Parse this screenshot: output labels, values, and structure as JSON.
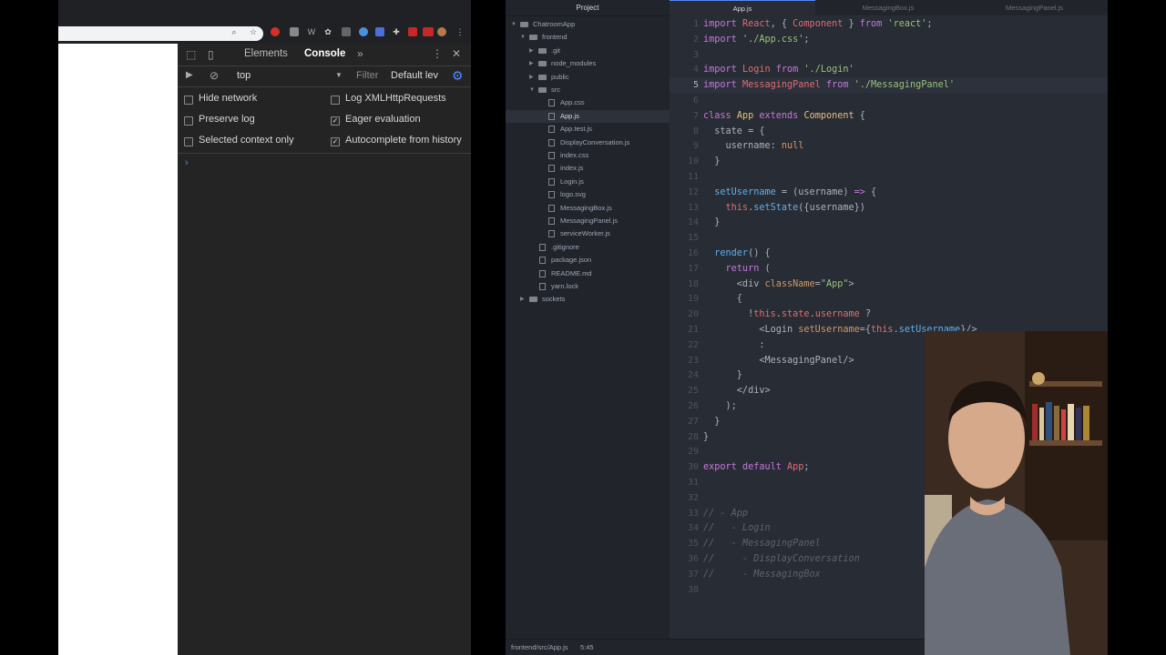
{
  "browser": {
    "toolbar_icons": [
      "search-icon",
      "star-icon",
      "extension-icon",
      "extension-icon",
      "extension-icon",
      "extension-icon",
      "extension-icon",
      "extension-icon",
      "extension-icon",
      "extension-icon",
      "extension-icon",
      "avatar",
      "more-icon"
    ],
    "devtools": {
      "tabs": [
        "Elements",
        "Console"
      ],
      "context": "top",
      "filter_placeholder": "Filter",
      "level": "Default lev",
      "options_left": [
        {
          "label": "Hide network",
          "checked": false
        },
        {
          "label": "Preserve log",
          "checked": false
        },
        {
          "label": "Selected context only",
          "checked": false
        }
      ],
      "options_right": [
        {
          "label": "Log XMLHttpRequests",
          "checked": false
        },
        {
          "label": "Eager evaluation",
          "checked": true
        },
        {
          "label": "Autocomplete from history",
          "checked": true
        }
      ],
      "prompt": "›"
    }
  },
  "editor": {
    "tree_header": "Project",
    "tree": [
      {
        "label": "ChatroomApp",
        "type": "folder",
        "depth": 0,
        "open": true
      },
      {
        "label": "frontend",
        "type": "folder",
        "depth": 1,
        "open": true
      },
      {
        "label": ".git",
        "type": "folder",
        "depth": 2,
        "open": false
      },
      {
        "label": "node_modules",
        "type": "folder",
        "depth": 2,
        "open": false
      },
      {
        "label": "public",
        "type": "folder",
        "depth": 2,
        "open": false
      },
      {
        "label": "src",
        "type": "folder",
        "depth": 2,
        "open": true
      },
      {
        "label": "App.css",
        "type": "file",
        "depth": 3
      },
      {
        "label": "App.js",
        "type": "file",
        "depth": 3,
        "selected": true
      },
      {
        "label": "App.test.js",
        "type": "file",
        "depth": 3
      },
      {
        "label": "DisplayConversation.js",
        "type": "file",
        "depth": 3
      },
      {
        "label": "index.css",
        "type": "file",
        "depth": 3
      },
      {
        "label": "index.js",
        "type": "file",
        "depth": 3
      },
      {
        "label": "Login.js",
        "type": "file",
        "depth": 3
      },
      {
        "label": "logo.svg",
        "type": "file",
        "depth": 3
      },
      {
        "label": "MessagingBox.js",
        "type": "file",
        "depth": 3
      },
      {
        "label": "MessagingPanel.js",
        "type": "file",
        "depth": 3
      },
      {
        "label": "serviceWorker.js",
        "type": "file",
        "depth": 3
      },
      {
        "label": ".gitignore",
        "type": "file",
        "depth": 2
      },
      {
        "label": "package.json",
        "type": "file",
        "depth": 2
      },
      {
        "label": "README.md",
        "type": "file",
        "depth": 2
      },
      {
        "label": "yarn.lock",
        "type": "file",
        "depth": 2
      },
      {
        "label": "sockets",
        "type": "folder",
        "depth": 1,
        "open": false
      }
    ],
    "tabs": [
      "App.js",
      "MessagingBox.js",
      "MessagingPanel.js"
    ],
    "active_tab": 0,
    "cursor_line": 5,
    "lines": [
      [
        [
          "import ",
          "kw"
        ],
        [
          "React",
          "var"
        ],
        [
          ", { ",
          "p"
        ],
        [
          "Component",
          "var"
        ],
        [
          " } ",
          "p"
        ],
        [
          "from ",
          "kw"
        ],
        [
          "'react'",
          "str"
        ],
        [
          ";",
          "p"
        ]
      ],
      [
        [
          "import ",
          "kw"
        ],
        [
          "'./App.css'",
          "str"
        ],
        [
          ";",
          "p"
        ]
      ],
      [],
      [
        [
          "import ",
          "kw"
        ],
        [
          "Login ",
          "var"
        ],
        [
          "from ",
          "kw"
        ],
        [
          "'./Login'",
          "str"
        ]
      ],
      [
        [
          "import ",
          "kw"
        ],
        [
          "MessagingPanel ",
          "var"
        ],
        [
          "from ",
          "kw"
        ],
        [
          "'./MessagingPanel'",
          "str"
        ]
      ],
      [],
      [
        [
          "class ",
          "kw"
        ],
        [
          "App ",
          "cls"
        ],
        [
          "extends ",
          "kw"
        ],
        [
          "Component",
          "cls"
        ],
        [
          " {",
          "p"
        ]
      ],
      [
        [
          "  state = {",
          "p"
        ]
      ],
      [
        [
          "    username: ",
          "p"
        ],
        [
          "null",
          "num"
        ]
      ],
      [
        [
          "  }",
          "p"
        ]
      ],
      [],
      [
        [
          "  setUsername ",
          "fn"
        ],
        [
          "= (username) ",
          "p"
        ],
        [
          "=>",
          "kw"
        ],
        [
          " {",
          "p"
        ]
      ],
      [
        [
          "    this",
          "var"
        ],
        [
          ".",
          "p"
        ],
        [
          "setState",
          "fn"
        ],
        [
          "({username})",
          "p"
        ]
      ],
      [
        [
          "  }",
          "p"
        ]
      ],
      [],
      [
        [
          "  render",
          "fn"
        ],
        [
          "() {",
          "p"
        ]
      ],
      [
        [
          "    return ",
          "kw"
        ],
        [
          "(",
          "p"
        ]
      ],
      [
        [
          "      <div ",
          "p"
        ],
        [
          "className",
          "num"
        ],
        [
          "=",
          "p"
        ],
        [
          "\"App\"",
          "str"
        ],
        [
          ">",
          "p"
        ]
      ],
      [
        [
          "      {",
          "p"
        ]
      ],
      [
        [
          "        !",
          "p"
        ],
        [
          "this",
          "var"
        ],
        [
          ".",
          "p"
        ],
        [
          "state",
          "var"
        ],
        [
          ".",
          "p"
        ],
        [
          "username",
          "var"
        ],
        [
          " ?",
          "p"
        ]
      ],
      [
        [
          "          <Login ",
          "p"
        ],
        [
          "setUsername",
          "num"
        ],
        [
          "={",
          "p"
        ],
        [
          "this",
          "var"
        ],
        [
          ".",
          "p"
        ],
        [
          "setUsername",
          "fn"
        ],
        [
          "}/>",
          "p"
        ]
      ],
      [
        [
          "          :",
          "p"
        ]
      ],
      [
        [
          "          <MessagingPanel/>",
          "p"
        ]
      ],
      [
        [
          "      }",
          "p"
        ]
      ],
      [
        [
          "      </div>",
          "p"
        ]
      ],
      [
        [
          "    );",
          "p"
        ]
      ],
      [
        [
          "  }",
          "p"
        ]
      ],
      [
        [
          "}",
          "p"
        ]
      ],
      [],
      [
        [
          "export ",
          "kw"
        ],
        [
          "default ",
          "kw"
        ],
        [
          "App",
          "var"
        ],
        [
          ";",
          "p"
        ]
      ],
      [],
      [],
      [
        [
          "// - App",
          "cmt"
        ]
      ],
      [
        [
          "//   - Login",
          "cmt"
        ]
      ],
      [
        [
          "//   - MessagingPanel",
          "cmt"
        ]
      ],
      [
        [
          "//     - DisplayConversation",
          "cmt"
        ]
      ],
      [
        [
          "//     - MessagingBox",
          "cmt"
        ]
      ],
      []
    ],
    "status_path": "frontend/src/App.js",
    "status_cursor": "5:45"
  },
  "colors": {
    "kw": "#c678dd",
    "var": "#e06c75",
    "str": "#98c379",
    "p": "#abb2bf",
    "cls": "#e5c07b",
    "fn": "#61afef",
    "num": "#d19a66",
    "cmt": "#5c6370"
  }
}
